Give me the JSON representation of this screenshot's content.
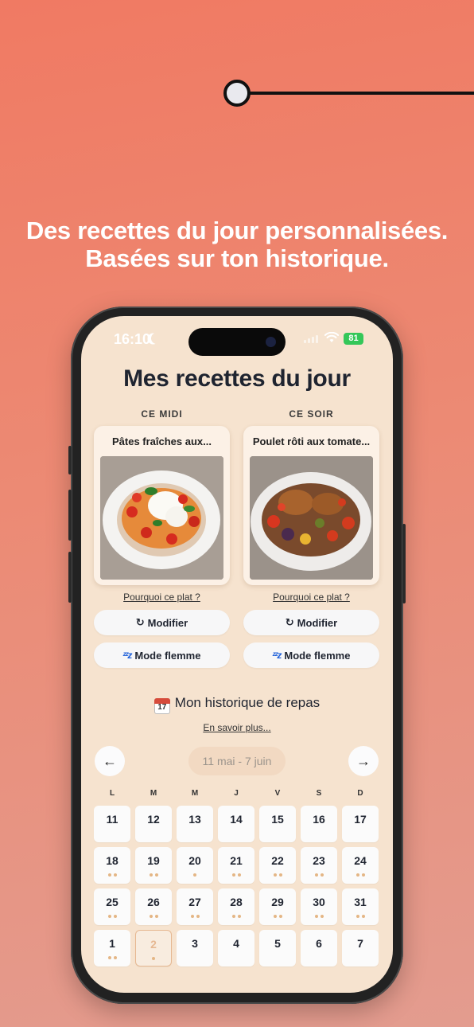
{
  "headline": {
    "line1": "Des recettes du jour personnalisées.",
    "line2": "Basées sur ton historique."
  },
  "status_bar": {
    "time": "16:10",
    "battery": "81"
  },
  "screen": {
    "title": "Mes recettes du jour",
    "meals": [
      {
        "slot": "CE MIDI",
        "dish": "Pâtes fraîches aux...",
        "image": "pasta-burrata-tomatoes-photo",
        "why_link": "Pourquoi ce plat ?",
        "modify_label": "Modifier",
        "lazy_label": "Mode flemme"
      },
      {
        "slot": "CE SOIR",
        "dish": "Poulet rôti aux tomate...",
        "image": "roast-chicken-vegetables-photo",
        "why_link": "Pourquoi ce plat ?",
        "modify_label": "Modifier",
        "lazy_label": "Mode flemme"
      }
    ],
    "history": {
      "title": "Mon historique de repas",
      "calendar_icon_day": "17",
      "learn_more": "En savoir plus...",
      "range": "11 mai - 7 juin",
      "prev_icon": "arrow-left-icon",
      "next_icon": "arrow-right-icon",
      "weekdays": [
        "L",
        "M",
        "M",
        "J",
        "V",
        "S",
        "D"
      ],
      "weeks": [
        [
          {
            "day": "11",
            "dots": 0
          },
          {
            "day": "12",
            "dots": 0
          },
          {
            "day": "13",
            "dots": 0
          },
          {
            "day": "14",
            "dots": 0
          },
          {
            "day": "15",
            "dots": 0
          },
          {
            "day": "16",
            "dots": 0
          },
          {
            "day": "17",
            "dots": 0
          }
        ],
        [
          {
            "day": "18",
            "dots": 2
          },
          {
            "day": "19",
            "dots": 2
          },
          {
            "day": "20",
            "dots": 1
          },
          {
            "day": "21",
            "dots": 2
          },
          {
            "day": "22",
            "dots": 2
          },
          {
            "day": "23",
            "dots": 2
          },
          {
            "day": "24",
            "dots": 2
          }
        ],
        [
          {
            "day": "25",
            "dots": 2
          },
          {
            "day": "26",
            "dots": 2
          },
          {
            "day": "27",
            "dots": 2
          },
          {
            "day": "28",
            "dots": 2
          },
          {
            "day": "29",
            "dots": 2
          },
          {
            "day": "30",
            "dots": 2
          },
          {
            "day": "31",
            "dots": 2
          }
        ],
        [
          {
            "day": "1",
            "dots": 2
          },
          {
            "day": "2",
            "dots": 1,
            "today": true
          },
          {
            "day": "3",
            "dots": 0
          },
          {
            "day": "4",
            "dots": 0
          },
          {
            "day": "5",
            "dots": 0
          },
          {
            "day": "6",
            "dots": 0
          },
          {
            "day": "7",
            "dots": 0
          }
        ]
      ]
    }
  },
  "colors": {
    "background_top": "#f07a63",
    "background_bottom": "#e39c8f",
    "screen_bg": "#f6e3cf",
    "meal_dot": "#e4b685",
    "today_accent": "#e6b892",
    "lazy_icon": "#1e5fd9"
  }
}
